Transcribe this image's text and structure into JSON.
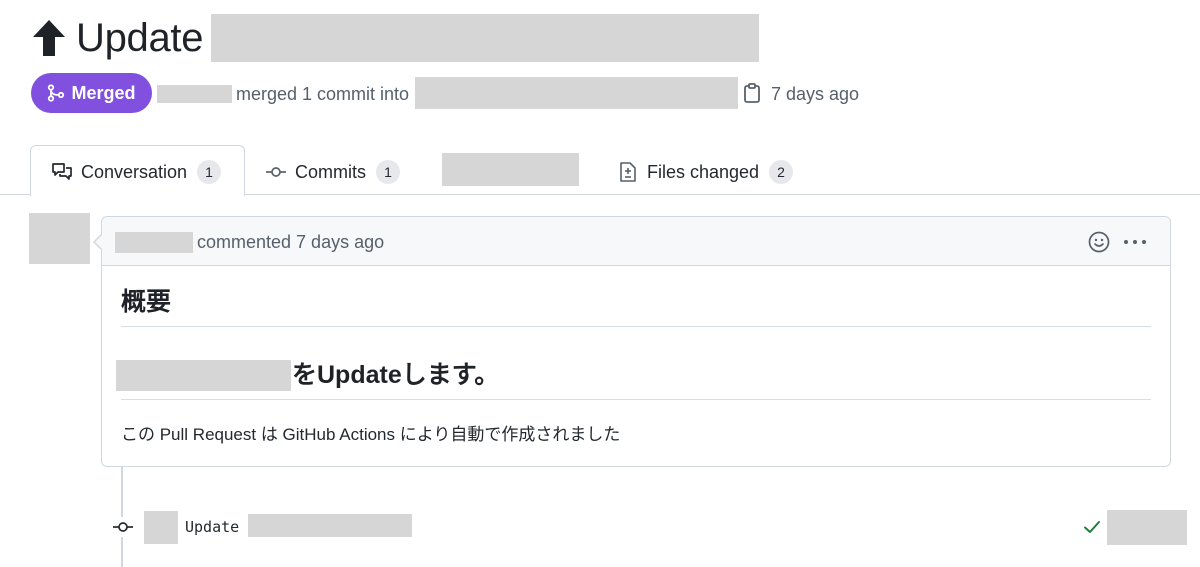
{
  "header": {
    "title_prefix": "Update",
    "status_badge": "Merged",
    "meta_merged_text": "merged 1 commit into",
    "meta_time": "7 days ago"
  },
  "tabs": [
    {
      "label": "Conversation",
      "count": "1",
      "icon": "comment-discussion-icon"
    },
    {
      "label": "Commits",
      "count": "1",
      "icon": "git-commit-icon"
    },
    {
      "label": "Files changed",
      "count": "2",
      "icon": "file-diff-icon"
    }
  ],
  "comment": {
    "action_text": "commented 7 days ago",
    "heading": "概要",
    "subheading_suffix": "をUpdateします。",
    "body": "この Pull Request は GitHub Actions により自動で作成されました"
  },
  "commit": {
    "message_prefix": "Update",
    "status": "success"
  },
  "colors": {
    "merged_purple": "#8250df",
    "success_green": "#1a7f37",
    "redaction_gray": "#d6d6d6"
  }
}
